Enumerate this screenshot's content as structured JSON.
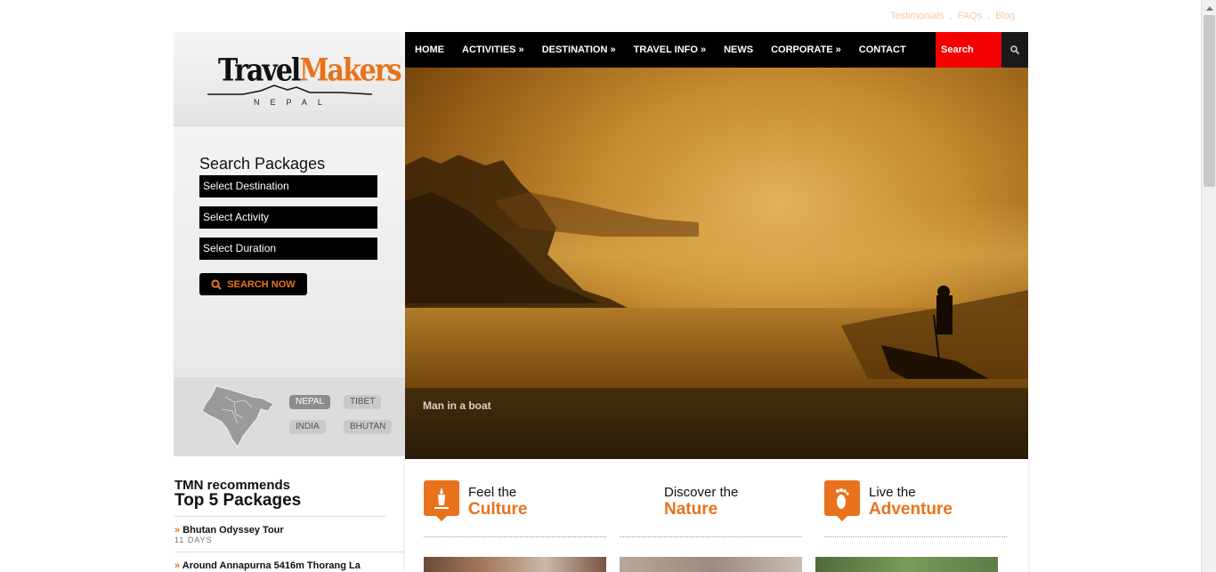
{
  "toplinks": {
    "testimonials": "Testimonials",
    "faqs": "FAQs",
    "blog": "Blog",
    "sep": ","
  },
  "logo": {
    "word_travel": "Travel",
    "word_makers": "Makers",
    "sub": "NEPAL"
  },
  "search_packages": {
    "title": "Search Packages",
    "destination": "Select Destination",
    "activity": "Select Activity",
    "duration": "Select Duration",
    "button": "SEARCH NOW"
  },
  "regions": {
    "nepal": "NEPAL",
    "tibet": "TIBET",
    "india": "INDIA",
    "bhutan": "BHUTAN",
    "selected": "NEPAL"
  },
  "recommend": {
    "line1": "TMN recommends",
    "line2": "Top 5 Packages",
    "packages": [
      {
        "name": "Bhutan Odyssey Tour",
        "days": "11 DAYS"
      },
      {
        "name": "Around Annapurna 5416m Thorang La",
        "days": ""
      }
    ]
  },
  "nav": {
    "items": [
      "HOME",
      "ACTIVITIES »",
      "DESTINATION »",
      "TRAVEL INFO »",
      "NEWS",
      "CORPORATE »",
      "CONTACT"
    ],
    "search_placeholder": "Search"
  },
  "hero": {
    "caption": "Man in a boat"
  },
  "features": [
    {
      "line1": "Feel the",
      "line2": "Culture",
      "icon": "culture-icon"
    },
    {
      "line1": "Discover the",
      "line2": "Nature",
      "icon": ""
    },
    {
      "line1": "Live the",
      "line2": "Adventure",
      "icon": "footprint-icon"
    }
  ],
  "colors": {
    "accent": "#e8731c",
    "nav_bg": "#000000",
    "search_bg": "#f50000"
  }
}
